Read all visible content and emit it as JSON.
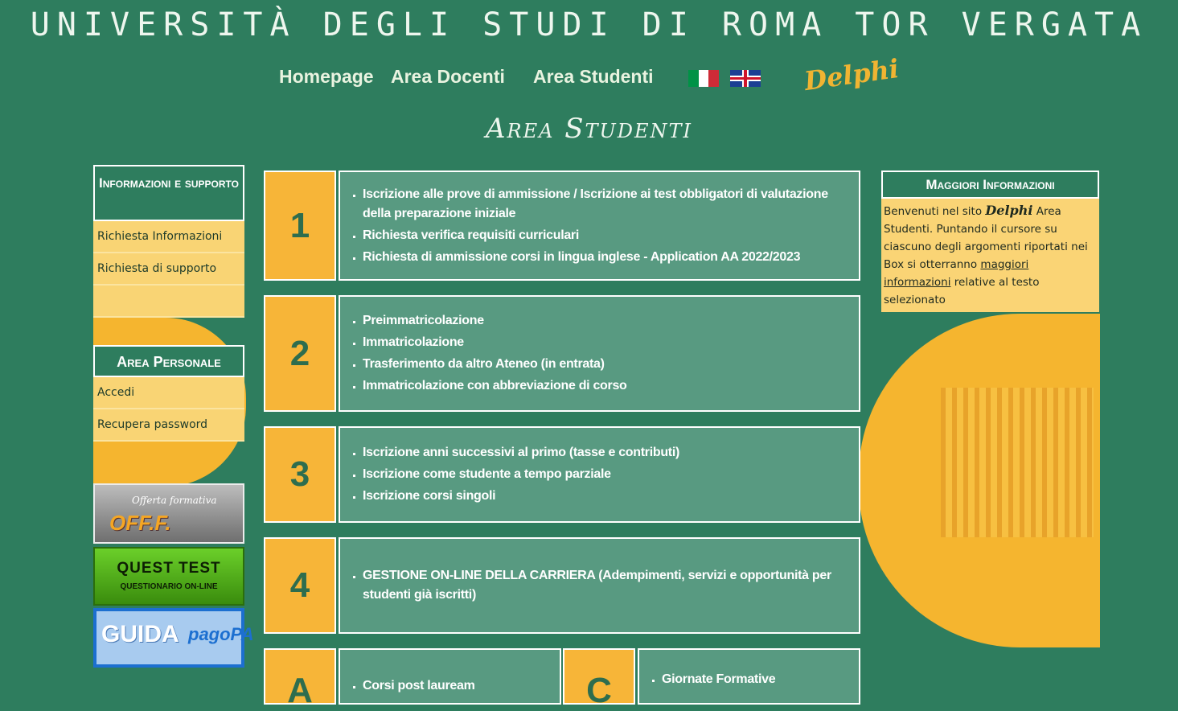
{
  "header": {
    "university_title": "UNIVERSITÀ DEGLI STUDI DI ROMA TOR VERGATA",
    "nav": [
      "Homepage",
      "Area Docenti",
      "Area Studenti"
    ],
    "logo_text": "Delphi",
    "section_title": "Area Studenti",
    "flags": [
      "italian-flag-icon",
      "uk-flag-icon"
    ]
  },
  "sidebar": {
    "info_box": {
      "title": "Informazioni e supporto",
      "items": [
        "Richiesta Informazioni",
        "Richiesta di supporto",
        ""
      ]
    },
    "personal_box": {
      "title": "Area Personale",
      "items": [
        "Accedi",
        "Recupera password"
      ]
    },
    "banners": {
      "offf_small": "Offerta formativa",
      "offf_big": "OFF.F.",
      "quest_big": "QUEST TEST",
      "quest_small": "QUESTIONARIO ON-LINE",
      "guida_big": "GUIDA",
      "guida_pa": "pagoPA"
    }
  },
  "rows": [
    {
      "number": "1",
      "items": [
        "Iscrizione alle prove di ammissione / Iscrizione ai test obbligatori di valutazione della preparazione iniziale",
        "Richiesta verifica requisiti curriculari",
        "Richiesta di ammissione corsi in lingua inglese - Application AA 2022/2023"
      ]
    },
    {
      "number": "2",
      "items": [
        "Preimmatricolazione",
        "Immatricolazione",
        "Trasferimento da altro Ateneo (in entrata)",
        "Immatricolazione con abbreviazione di corso"
      ]
    },
    {
      "number": "3",
      "items": [
        "Iscrizione anni successivi al primo (tasse e contributi)",
        "Iscrizione come studente a tempo parziale",
        "Iscrizione corsi singoli"
      ]
    },
    {
      "number": "4",
      "items": [
        "GESTIONE ON-LINE DELLA CARRIERA (Adempimenti, servizi e opportunità per studenti già iscritti)"
      ]
    }
  ],
  "bottom_rows": [
    {
      "number": "A",
      "items": [
        "Corsi post lauream"
      ]
    },
    {
      "number": "C",
      "items": [
        "Giornate Formative"
      ]
    }
  ],
  "more_info": {
    "title": "Maggiori Informazioni",
    "text_1": "Benvenuti nel sito ",
    "delphi": "Delphi",
    "text_2": " Area Studenti. Puntando il cursore su ciascuno degli argomenti riportati nei Box si otterranno ",
    "link": "maggiori informazioni",
    "text_3": " relative al testo selezionato"
  },
  "colors": {
    "background": "#2e7d5e",
    "accent_yellow": "#f7b538",
    "light_yellow": "#f9d474"
  }
}
